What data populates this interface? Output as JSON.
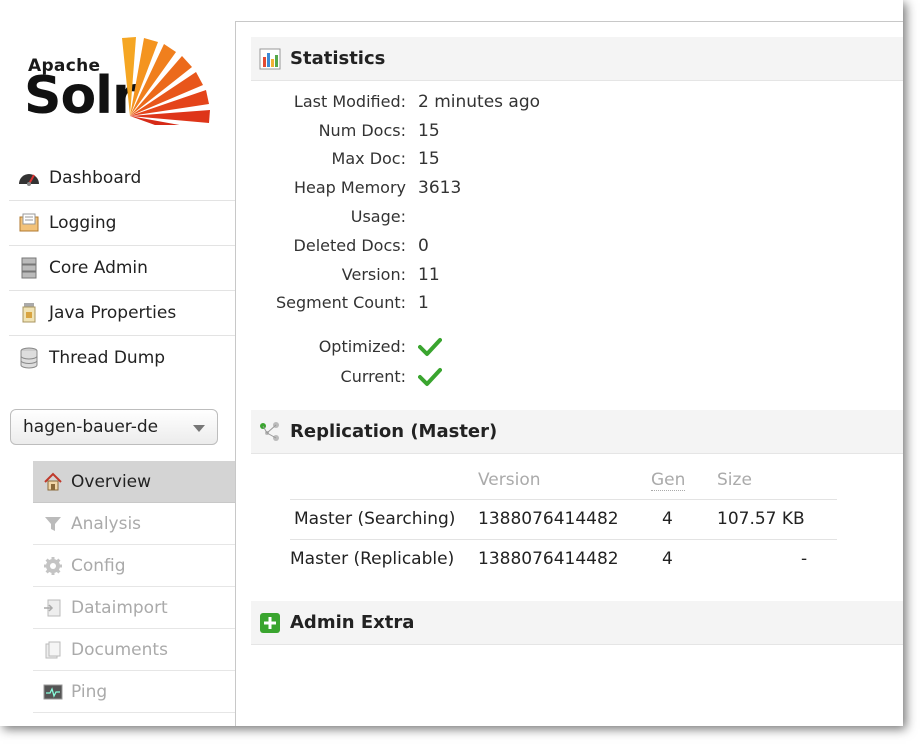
{
  "logo": {
    "apache": "Apache",
    "solr": "Solr"
  },
  "nav": [
    {
      "label": "Dashboard",
      "icon": "dashboard-icon"
    },
    {
      "label": "Logging",
      "icon": "logging-icon"
    },
    {
      "label": "Core Admin",
      "icon": "core-admin-icon"
    },
    {
      "label": "Java Properties",
      "icon": "java-properties-icon"
    },
    {
      "label": "Thread Dump",
      "icon": "thread-dump-icon"
    }
  ],
  "core_selector": {
    "value": "hagen-bauer-de"
  },
  "core_menu": [
    {
      "label": "Overview",
      "icon": "home-icon",
      "active": true
    },
    {
      "label": "Analysis",
      "icon": "funnel-icon"
    },
    {
      "label": "Config",
      "icon": "gear-icon"
    },
    {
      "label": "Dataimport",
      "icon": "dataimport-icon"
    },
    {
      "label": "Documents",
      "icon": "documents-icon"
    },
    {
      "label": "Ping",
      "icon": "ping-icon"
    }
  ],
  "statistics": {
    "title": "Statistics",
    "rows": [
      {
        "label": "Last Modified:",
        "value": "2 minutes ago"
      },
      {
        "label": "Num Docs:",
        "value": "15"
      },
      {
        "label": "Max Doc:",
        "value": "15"
      },
      {
        "label": "Heap Memory",
        "value": "3613"
      },
      {
        "label": "Usage:",
        "value": ""
      },
      {
        "label": "Deleted Docs:",
        "value": "0"
      },
      {
        "label": "Version:",
        "value": "11"
      },
      {
        "label": "Segment Count:",
        "value": "1"
      }
    ],
    "flags": [
      {
        "label": "Optimized:",
        "icon": "check-icon"
      },
      {
        "label": "Current:",
        "icon": "check-icon"
      }
    ]
  },
  "replication": {
    "title": "Replication (Master)",
    "headers": {
      "version": "Version",
      "gen": "Gen",
      "size": "Size"
    },
    "rows": [
      {
        "name": "Master (Searching)",
        "version": "1388076414482",
        "gen": "4",
        "size": "107.57 KB"
      },
      {
        "name": "Master (Replicable)",
        "version": "1388076414482",
        "gen": "4",
        "size": "-"
      }
    ]
  },
  "admin_extra": {
    "title": "Admin Extra"
  },
  "colors": {
    "check": "#3aa52f",
    "sun_orange": "#e8501b",
    "active_bg": "#d4d4d4"
  }
}
